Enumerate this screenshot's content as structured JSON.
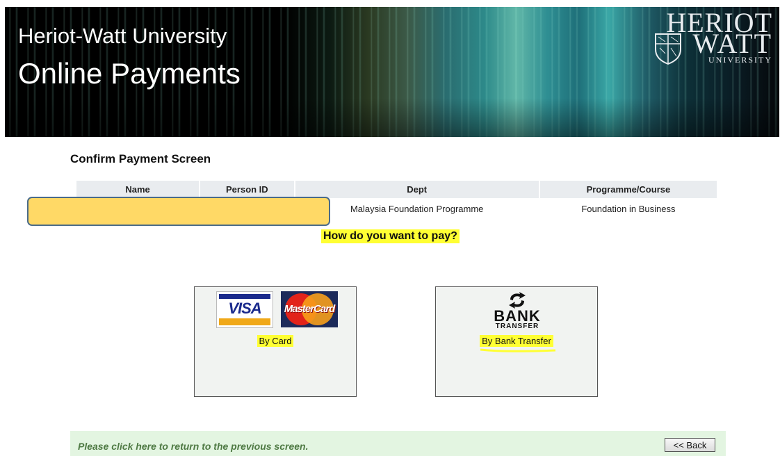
{
  "header": {
    "university": "Heriot-Watt University",
    "title": "Online Payments",
    "logo": {
      "line1": "HERIOT",
      "line2": "WATT",
      "line3": "UNIVERSITY"
    }
  },
  "page": {
    "heading": "Confirm Payment Screen"
  },
  "table": {
    "headers": {
      "name": "Name",
      "person_id": "Person ID",
      "dept": "Dept",
      "programme": "Programme/Course"
    },
    "row": {
      "name": "",
      "person_id": "",
      "dept": "Malaysia Foundation Programme",
      "programme": "Foundation in Business"
    }
  },
  "question": "How do you want to pay?",
  "options": {
    "card": {
      "label": "By Card",
      "visa_text": "VISA",
      "mc_text": "MasterCard"
    },
    "bank": {
      "label": "By Bank Transfer",
      "logo_word": "BANK",
      "logo_sub": "TRANSFER"
    }
  },
  "footer": {
    "text": "Please click here to return to the previous screen.",
    "back_label": "<< Back"
  },
  "colors": {
    "highlight": "#ffff33",
    "redaction": "#ffd966",
    "footer_bg": "#e3f5e1",
    "footer_text": "#4f7a44"
  }
}
